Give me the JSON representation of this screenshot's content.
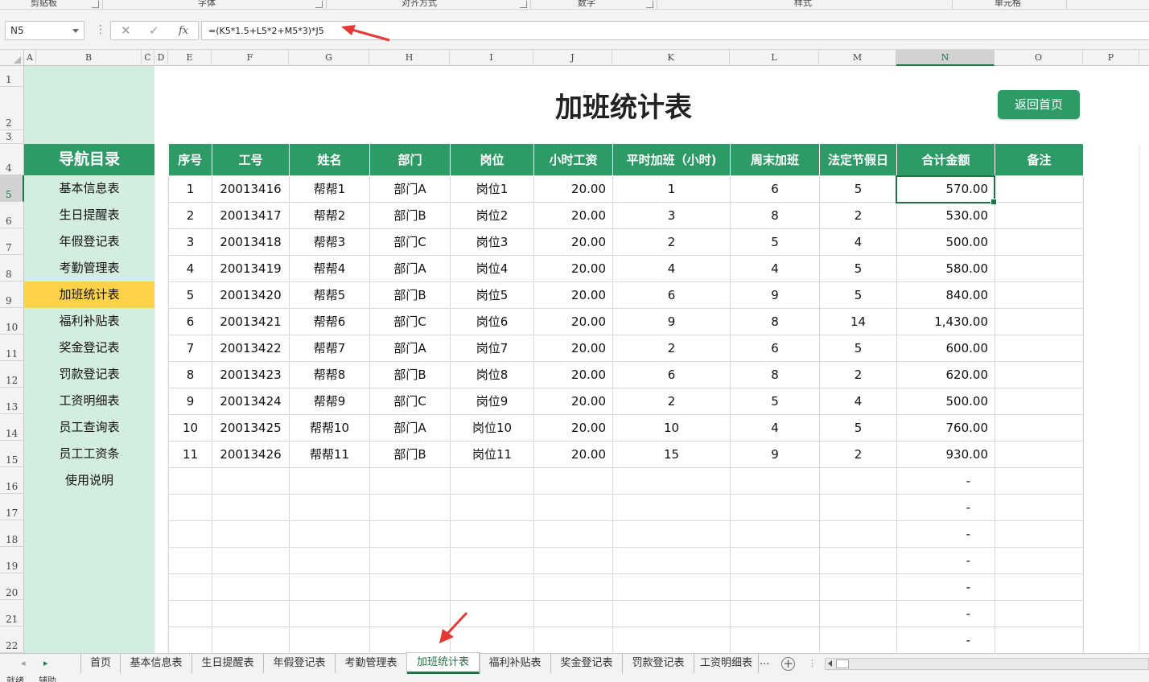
{
  "ribbon": {
    "groups": [
      "剪贴板",
      "字体",
      "对齐方式",
      "数字",
      "样式",
      "单元格"
    ]
  },
  "formula_bar": {
    "name_box": "N5",
    "cancel_icon": "✕",
    "confirm_icon": "✓",
    "fx_label": "fx",
    "formula": "=(K5*1.5+L5*2+M5*3)*J5"
  },
  "columns": [
    "A",
    "B",
    "C",
    "D",
    "E",
    "F",
    "G",
    "H",
    "I",
    "J",
    "K",
    "L",
    "M",
    "N",
    "O",
    "P"
  ],
  "selected_column": "N",
  "rows": [
    "1",
    "2",
    "3",
    "4",
    "5",
    "6",
    "7",
    "8",
    "9",
    "10",
    "11",
    "12",
    "13",
    "14",
    "15",
    "16",
    "17",
    "18",
    "19",
    "20",
    "21",
    "22"
  ],
  "selected_row": "5",
  "nav": {
    "title": "导航目录",
    "items": [
      "基本信息表",
      "生日提醒表",
      "年假登记表",
      "考勤管理表",
      "加班统计表",
      "福利补贴表",
      "奖金登记表",
      "罚款登记表",
      "工资明细表",
      "员工查询表",
      "员工工资条",
      "使用说明"
    ],
    "active": "加班统计表"
  },
  "sheet": {
    "title": "加班统计表",
    "back_button": "返回首页"
  },
  "table": {
    "headers": [
      "序号",
      "工号",
      "姓名",
      "部门",
      "岗位",
      "小时工资",
      "平时加班（小时)",
      "周末加班",
      "法定节假日",
      "合计金额",
      "备注"
    ],
    "rows": [
      [
        "1",
        "20013416",
        "帮帮1",
        "部门A",
        "岗位1",
        "20.00",
        "1",
        "6",
        "5",
        "570.00",
        ""
      ],
      [
        "2",
        "20013417",
        "帮帮2",
        "部门B",
        "岗位2",
        "20.00",
        "3",
        "8",
        "2",
        "530.00",
        ""
      ],
      [
        "3",
        "20013418",
        "帮帮3",
        "部门C",
        "岗位3",
        "20.00",
        "2",
        "5",
        "4",
        "500.00",
        ""
      ],
      [
        "4",
        "20013419",
        "帮帮4",
        "部门A",
        "岗位4",
        "20.00",
        "4",
        "4",
        "5",
        "580.00",
        ""
      ],
      [
        "5",
        "20013420",
        "帮帮5",
        "部门B",
        "岗位5",
        "20.00",
        "6",
        "9",
        "5",
        "840.00",
        ""
      ],
      [
        "6",
        "20013421",
        "帮帮6",
        "部门C",
        "岗位6",
        "20.00",
        "9",
        "8",
        "14",
        "1,430.00",
        ""
      ],
      [
        "7",
        "20013422",
        "帮帮7",
        "部门A",
        "岗位7",
        "20.00",
        "2",
        "6",
        "5",
        "600.00",
        ""
      ],
      [
        "8",
        "20013423",
        "帮帮8",
        "部门B",
        "岗位8",
        "20.00",
        "6",
        "8",
        "2",
        "620.00",
        ""
      ],
      [
        "9",
        "20013424",
        "帮帮9",
        "部门C",
        "岗位9",
        "20.00",
        "2",
        "5",
        "4",
        "500.00",
        ""
      ],
      [
        "10",
        "20013425",
        "帮帮10",
        "部门A",
        "岗位10",
        "20.00",
        "10",
        "4",
        "5",
        "760.00",
        ""
      ],
      [
        "11",
        "20013426",
        "帮帮11",
        "部门B",
        "岗位11",
        "20.00",
        "15",
        "9",
        "2",
        "930.00",
        ""
      ]
    ],
    "empty_total": "-"
  },
  "tabs": {
    "items": [
      "首页",
      "基本信息表",
      "生日提醒表",
      "年假登记表",
      "考勤管理表",
      "加班统计表",
      "福利补贴表",
      "奖金登记表",
      "罚款登记表",
      "工资明细表"
    ],
    "active": "加班统计表",
    "more": "...",
    "add": "+"
  },
  "status": {
    "left": "就绪",
    "mode": "辅助"
  },
  "colors": {
    "header_green": "#2e9b67",
    "nav_bg": "#d4ede1",
    "active_yellow": "#ffd24a",
    "excel_green": "#217346",
    "arrow_red": "#e53935"
  },
  "icons": {
    "name_box_dropdown": "chevron-down-icon",
    "cancel": "close-icon",
    "confirm": "check-icon",
    "fx": "function-icon",
    "arrow": "red-arrow-icon",
    "add_sheet": "plus-circle-icon"
  }
}
